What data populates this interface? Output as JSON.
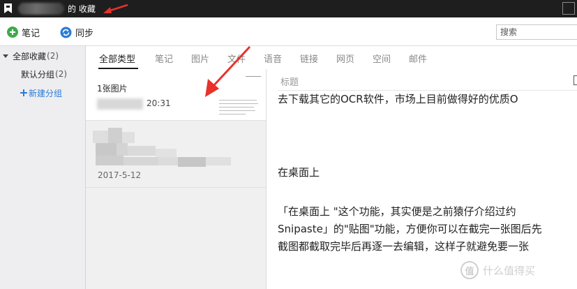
{
  "titlebar": {
    "title_suffix": "的 收藏"
  },
  "toolbar": {
    "note_label": "笔记",
    "sync_label": "同步",
    "search_placeholder": "搜索"
  },
  "sidebar": {
    "all_label": "全部收藏",
    "all_count": "(2)",
    "default_label": "默认分组",
    "default_count": "(2)",
    "new_group_label": "新建分组"
  },
  "tabs": [
    "全部类型",
    "笔记",
    "图片",
    "文件",
    "语音",
    "链接",
    "网页",
    "空间",
    "邮件"
  ],
  "active_tab": 0,
  "notes": [
    {
      "title": "1张图片",
      "time": "20:31"
    },
    {
      "date": "2017-5-12"
    }
  ],
  "editor": {
    "header": "标题",
    "lines": [
      "去下载其它的OCR软件，市场上目前做得好的优质O",
      "在桌面上",
      "「在桌面上 \"这个功能，其实便是之前猿仔介绍过约",
      "Snipaste」的\"贴图\"功能，方便你可以在截完一张图后先",
      "截图都截取完毕后再逐一去编辑，这样子就避免要一张"
    ]
  },
  "watermark": {
    "text": "什么值得买",
    "logo": "值"
  },
  "colors": {
    "arrow": "#e8312b",
    "add_green": "#3daa4a",
    "sync_blue": "#2b7bd6"
  }
}
